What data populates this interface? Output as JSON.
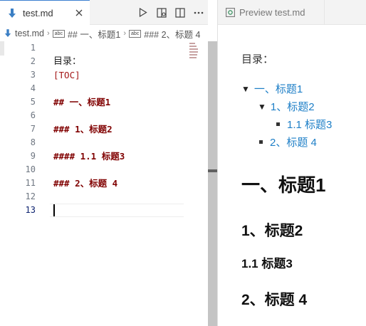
{
  "editor": {
    "tab": {
      "label": "test.md",
      "close_icon": "close-icon"
    },
    "actions": [
      "run-icon",
      "open-preview-icon",
      "split-editor-icon",
      "more-actions-icon"
    ],
    "breadcrumb": [
      "test.md",
      "## 一、标题1",
      "### 2、标题 4"
    ],
    "breadcrumb_badge": "abc",
    "line_numbers": [
      "1",
      "2",
      "3",
      "4",
      "5",
      "6",
      "7",
      "8",
      "9",
      "10",
      "11",
      "12",
      "13"
    ],
    "current_line": "13",
    "lines": [
      "",
      "目录：",
      "[TOC]",
      "",
      "## 一、标题1",
      "",
      "### 1、标题2",
      "",
      "#### 1.1 标题3",
      "",
      "### 2、标题 4",
      "",
      ""
    ]
  },
  "preview": {
    "tab": {
      "label": "Preview test.md"
    },
    "toc_label": "目录：",
    "toc": [
      {
        "marker": "▼",
        "text": "一、标题1"
      },
      {
        "marker": "▼",
        "text": "1、标题2"
      },
      {
        "marker": "■",
        "text": "1.1 标题3"
      },
      {
        "marker": "■",
        "text": "2、标题 4"
      }
    ],
    "headings": {
      "h1": "一、标题1",
      "h2a": "1、标题2",
      "h3": "1.1 标题3",
      "h2b": "2、标题 4"
    }
  },
  "colors": {
    "accent": "#3c7fd0",
    "toc_link": "#1e7fc7",
    "heading_code": "#800000",
    "toc_code": "#a31515"
  }
}
